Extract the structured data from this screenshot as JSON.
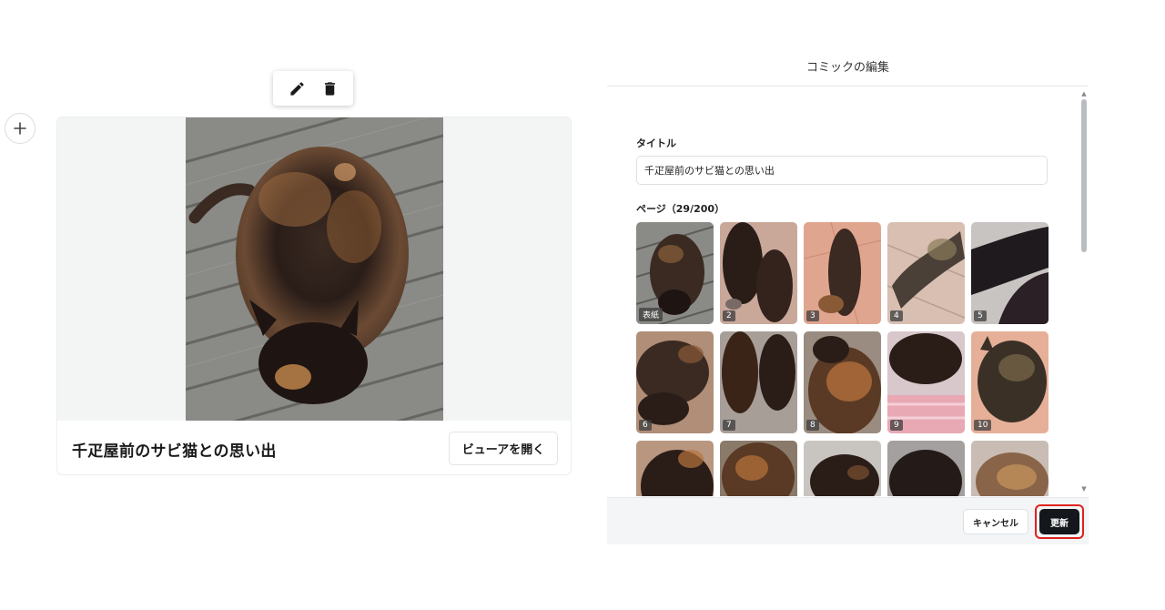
{
  "editor": {
    "add_block_icon": "plus-icon",
    "toolbar": {
      "edit_icon": "pencil-icon",
      "delete_icon": "trash-icon"
    },
    "card": {
      "title": "千疋屋前のサビ猫との思い出",
      "viewer_button": "ビューアを開く"
    }
  },
  "modal": {
    "title": "コミックの編集",
    "title_label": "タイトル",
    "title_value": "千疋屋前のサビ猫との思い出",
    "pages_label": "ページ（29/200）",
    "pages": [
      {
        "badge": "表紙"
      },
      {
        "badge": "2"
      },
      {
        "badge": "3"
      },
      {
        "badge": "4"
      },
      {
        "badge": "5"
      },
      {
        "badge": "6"
      },
      {
        "badge": "7"
      },
      {
        "badge": "8"
      },
      {
        "badge": "9"
      },
      {
        "badge": "10"
      },
      {
        "badge": ""
      },
      {
        "badge": ""
      },
      {
        "badge": ""
      },
      {
        "badge": ""
      },
      {
        "badge": ""
      }
    ],
    "cancel_button": "キャンセル",
    "update_button": "更新"
  },
  "colors": {
    "update_button_bg": "#14181c",
    "highlight_ring": "#e0211c",
    "cat_fur_dark": "#2a1c16",
    "cat_fur_orange": "#b8733c"
  }
}
